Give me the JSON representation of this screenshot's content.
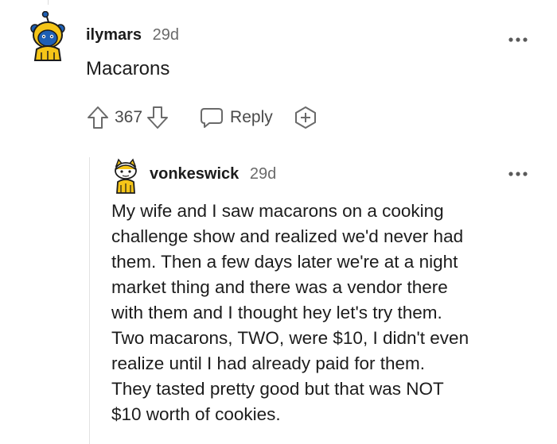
{
  "comment": {
    "username": "ilymars",
    "age": "29d",
    "text": "Macarons",
    "vote_count": "367",
    "reply_label": "Reply",
    "icons": {
      "avatar": "snoo-avatar-icon",
      "upvote": "arrow-up-icon",
      "downvote": "arrow-down-icon",
      "reply": "speech-bubble-icon",
      "award": "award-plus-icon",
      "more": "more-dots-icon"
    }
  },
  "reply": {
    "username": "vonkeswick",
    "age": "29d",
    "text": "My wife and I saw macarons on a cooking\nchallenge show and realized we'd never had\nthem. Then a few days later we're at a night\nmarket thing and there was a vendor there\nwith them and I thought hey let's try them.\nTwo macarons, TWO, were $10, I didn't even\nrealize until I had already paid for them.\nThey tasted pretty good but that was NOT\n$10 worth of cookies."
  },
  "colors": {
    "avatar_yellow": "#f5c518",
    "avatar_blue": "#1e5fb4",
    "icon_gray": "#6a6a6a",
    "thread_line": "#e2e2e2"
  }
}
